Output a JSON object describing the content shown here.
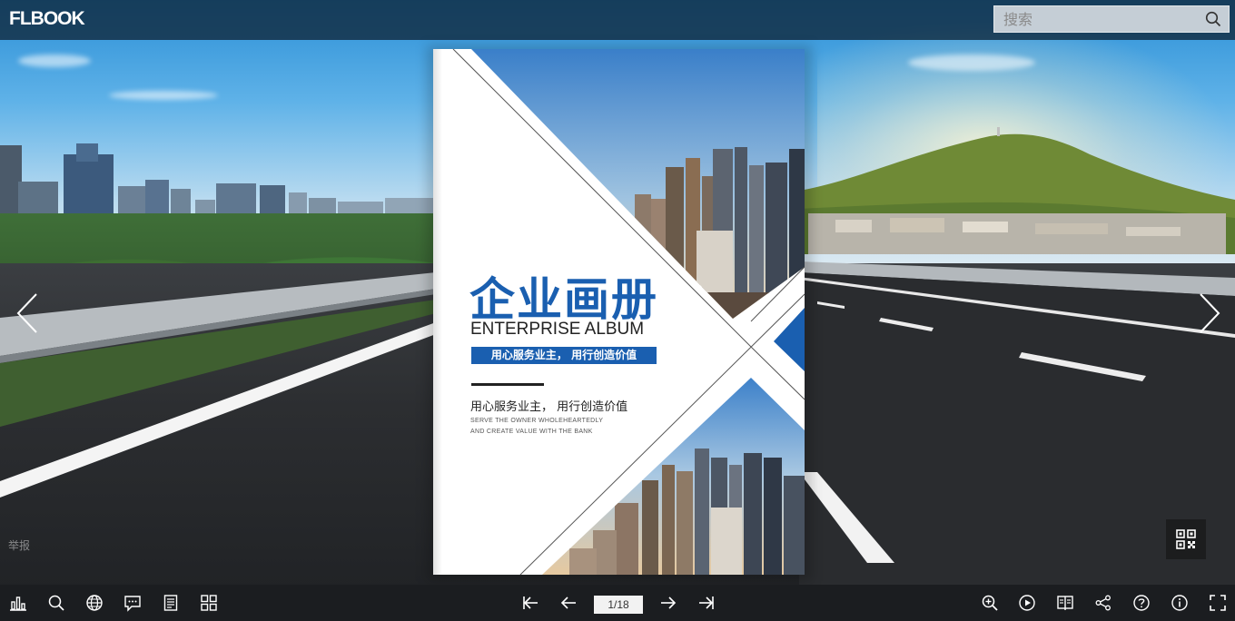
{
  "header": {
    "logo": "FLBOOK",
    "search_placeholder": "搜索"
  },
  "cover": {
    "title": "企业画册",
    "subtitle": "ENTERPRISE ALBUM",
    "tagline": "用心服务业主，  用行创造价值",
    "slogan": "用心服务业主，  用行创造价值",
    "english_line1": "SERVE THE OWNER WHOLEHEARTEDLY",
    "english_line2": "AND CREATE VALUE WITH THE BANK",
    "accent_color": "#1a5fb0"
  },
  "side_links": {
    "report": "举报"
  },
  "toolbar": {
    "left_icons": [
      "bar-chart-icon",
      "search-icon",
      "globe-icon",
      "comment-icon",
      "document-icon",
      "grid-icon"
    ],
    "page_indicator": "1/18",
    "current_page": 1,
    "total_pages": 18,
    "right_icons": [
      "zoom-in-icon",
      "play-icon",
      "book-icon",
      "share-icon",
      "help-icon",
      "info-icon",
      "fullscreen-icon"
    ]
  }
}
